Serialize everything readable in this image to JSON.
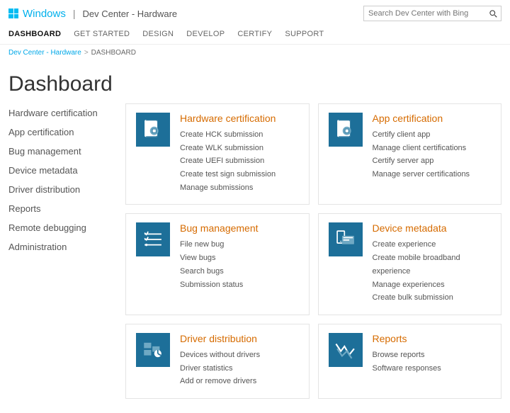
{
  "header": {
    "brand": "Windows",
    "subtitle": "Dev Center - Hardware",
    "search_placeholder": "Search Dev Center with Bing"
  },
  "nav": {
    "items": [
      "DASHBOARD",
      "GET STARTED",
      "DESIGN",
      "DEVELOP",
      "CERTIFY",
      "SUPPORT"
    ],
    "active_index": 0
  },
  "breadcrumb": {
    "items": [
      "Dev Center - Hardware",
      "DASHBOARD"
    ]
  },
  "page_title": "Dashboard",
  "sidebar": {
    "items": [
      "Hardware certification",
      "App certification",
      "Bug management",
      "Device metadata",
      "Driver distribution",
      "Reports",
      "Remote debugging",
      "Administration"
    ]
  },
  "cards": [
    {
      "icon": "cert-icon",
      "title": "Hardware certification",
      "links": [
        "Create HCK submission",
        "Create WLK submission",
        "Create UEFI submission",
        "Create test sign submission",
        "Manage submissions"
      ]
    },
    {
      "icon": "app-cert-icon",
      "title": "App certification",
      "links": [
        "Certify client app",
        "Manage client certifications",
        "Certify server app",
        "Manage server certifications"
      ]
    },
    {
      "icon": "bug-icon",
      "title": "Bug management",
      "links": [
        "File new bug",
        "View bugs",
        "Search bugs",
        "Submission status"
      ]
    },
    {
      "icon": "device-icon",
      "title": "Device metadata",
      "links": [
        "Create experience",
        "Create mobile broadband experience",
        "Manage experiences",
        "Create bulk submission"
      ]
    },
    {
      "icon": "driver-icon",
      "title": "Driver distribution",
      "links": [
        "Devices without drivers",
        "Driver statistics",
        "Add or remove drivers"
      ]
    },
    {
      "icon": "reports-icon",
      "title": "Reports",
      "links": [
        "Browse reports",
        "Software responses"
      ]
    }
  ]
}
